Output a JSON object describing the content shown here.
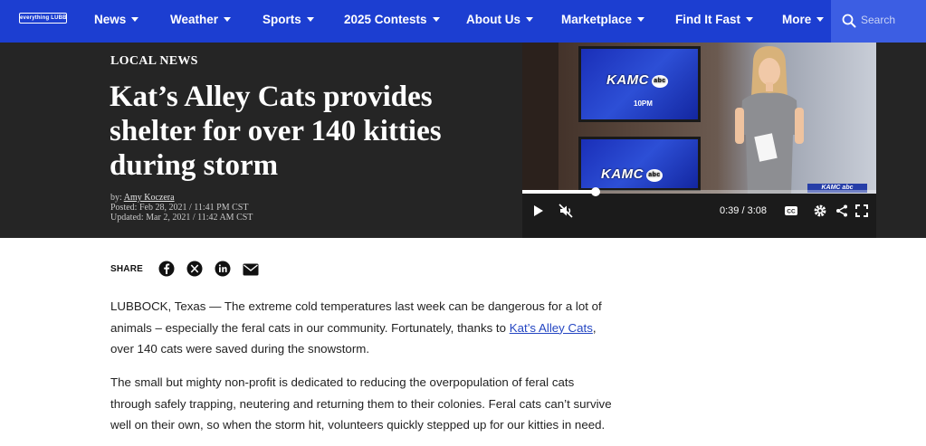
{
  "nav": {
    "logo_text": "everything LUBBOCK",
    "items": [
      {
        "label": "News"
      },
      {
        "label": "Weather"
      },
      {
        "label": "Sports"
      },
      {
        "label": "2025 Contests"
      },
      {
        "label": "About Us"
      },
      {
        "label": "Marketplace"
      },
      {
        "label": "Find It Fast"
      },
      {
        "label": "More"
      }
    ],
    "search_placeholder": "Search",
    "color": "#1c3ed1"
  },
  "article": {
    "section": "LOCAL NEWS",
    "headline": "Kat’s Alley Cats provides shelter for over 140 kitties during storm",
    "byline_prefix": "by: ",
    "author": "Amy Koczera",
    "posted": "Posted: Feb 28, 2021 / 11:41 PM CST",
    "updated": "Updated: Mar 2, 2021 / 11:42 AM CST",
    "share_label": "SHARE",
    "share_icons": [
      "facebook-icon",
      "x-icon",
      "linkedin-icon",
      "email-icon"
    ],
    "paragraphs": [
      {
        "before": "LUBBOCK, Texas — The extreme cold temperatures last week can be dangerous for a lot of animals – especially the feral cats in our community. Fortunately, thanks to ",
        "link": "Kat’s Alley Cats",
        "after": ", over 140 cats were saved during the snowstorm."
      },
      {
        "text": "The small but mighty non-profit is dedicated to reducing the overpopulation of feral cats through safely trapping, neutering and returning them to their colonies. Feral cats can’t survive well on their own, so when the storm hit, volunteers quickly stepped up for our kitties in need."
      }
    ]
  },
  "video": {
    "brand": "KAMC",
    "network": "abc",
    "slot": "10PM",
    "lower_third": "KAMC abc",
    "current_time": "0:39",
    "duration": "3:08",
    "progress_fraction": 0.207,
    "state": "paused",
    "muted": true
  }
}
